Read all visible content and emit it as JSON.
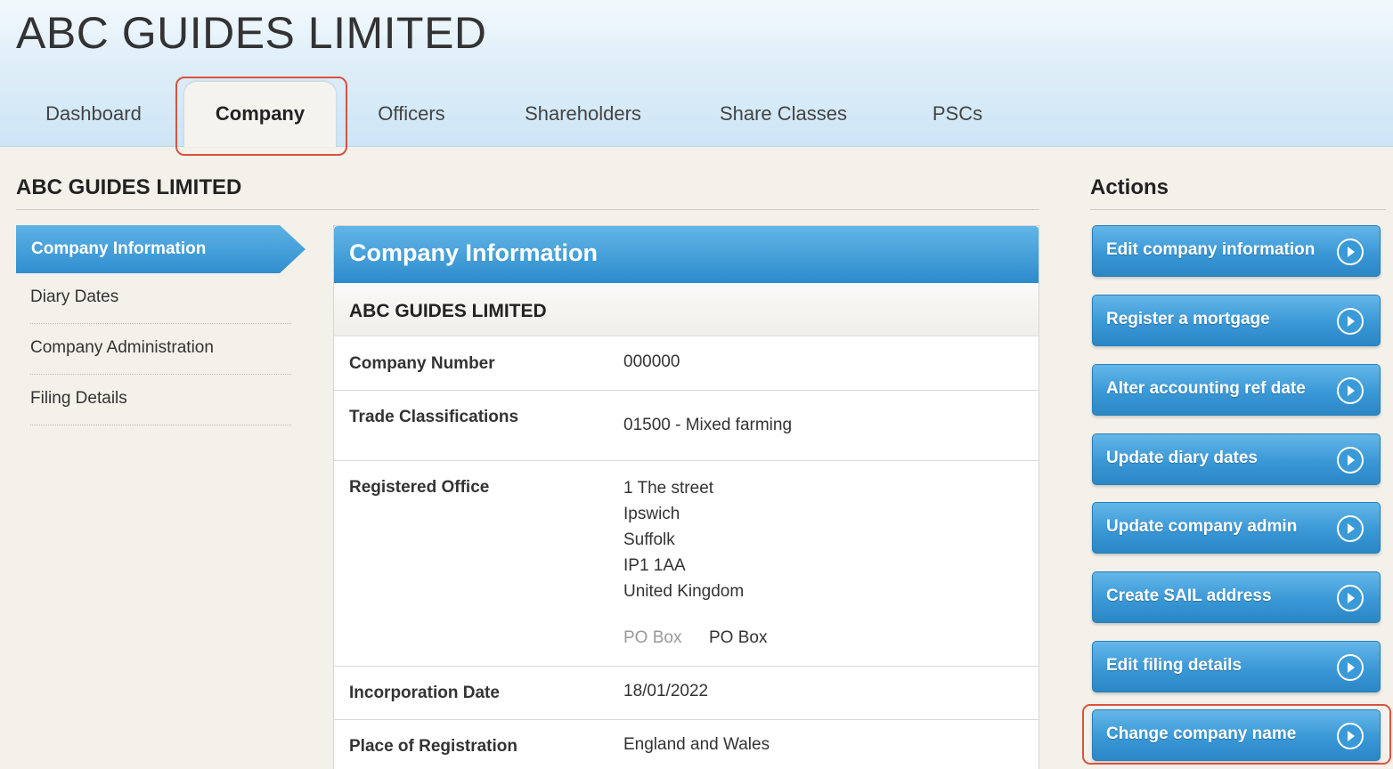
{
  "header": {
    "app_title": "ABC GUIDES LIMITED",
    "tabs": [
      {
        "label": "Dashboard"
      },
      {
        "label": "Company"
      },
      {
        "label": "Officers"
      },
      {
        "label": "Shareholders"
      },
      {
        "label": "Share Classes"
      },
      {
        "label": "PSCs"
      }
    ],
    "active_tab": "Company"
  },
  "section_title": "ABC GUIDES LIMITED",
  "left_nav": {
    "items": [
      {
        "label": "Company Information"
      },
      {
        "label": "Diary Dates"
      },
      {
        "label": "Company Administration"
      },
      {
        "label": "Filing Details"
      }
    ],
    "active": "Company Information"
  },
  "panel": {
    "title": "Company Information",
    "company_name": "ABC GUIDES LIMITED",
    "rows": {
      "company_number": {
        "label": "Company Number",
        "value": "000000"
      },
      "trade_classifications": {
        "label": "Trade Classifications",
        "value": "01500 - Mixed farming"
      },
      "registered_office": {
        "label": "Registered Office",
        "lines": [
          "1 The street",
          "Ipswich",
          "Suffolk",
          "IP1 1AA",
          "United Kingdom"
        ],
        "po_box_label": "PO Box",
        "po_box_value": "PO Box"
      },
      "incorporation_date": {
        "label": "Incorporation Date",
        "value": "18/01/2022"
      },
      "place_of_registration": {
        "label": "Place of Registration",
        "value": "England and Wales"
      }
    }
  },
  "actions": {
    "title": "Actions",
    "buttons": [
      {
        "label": "Edit company information",
        "icon": "arrow-right-circle-icon"
      },
      {
        "label": "Register a mortgage",
        "icon": "arrow-right-circle-icon"
      },
      {
        "label": "Alter accounting ref date",
        "icon": "arrow-right-circle-icon"
      },
      {
        "label": "Update diary dates",
        "icon": "arrow-right-circle-icon"
      },
      {
        "label": "Update company admin",
        "icon": "arrow-right-circle-icon"
      },
      {
        "label": "Create SAIL address",
        "icon": "arrow-right-circle-icon"
      },
      {
        "label": "Edit filing details",
        "icon": "arrow-right-circle-icon"
      },
      {
        "label": "Change company name",
        "icon": "arrow-right-circle-icon"
      }
    ]
  },
  "colors": {
    "accent_blue": "#2f8fcf",
    "highlight_red": "#d9533f"
  }
}
